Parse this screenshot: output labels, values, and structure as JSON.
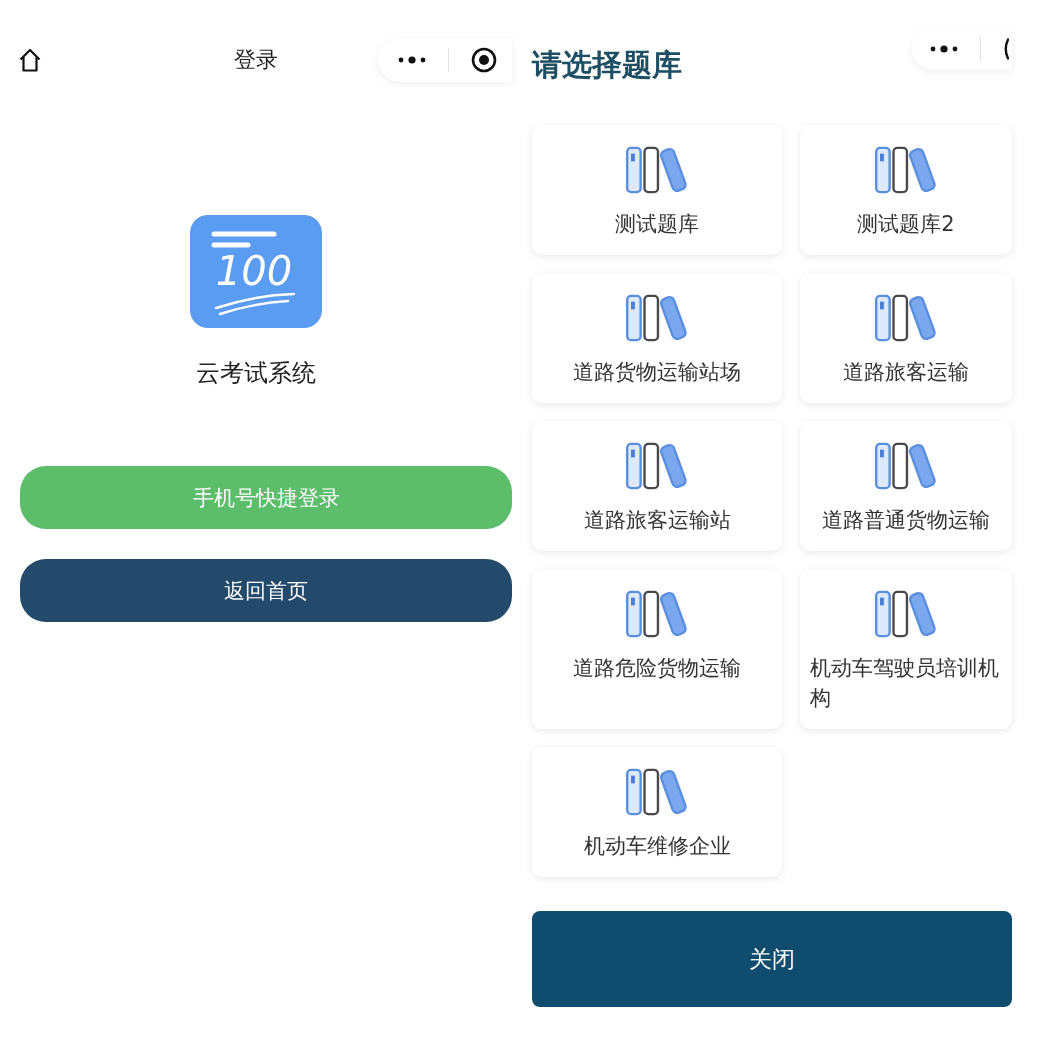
{
  "login_page": {
    "nav_bar": {
      "title": "登录"
    },
    "logo": {
      "text": "100"
    },
    "app_name": "云考试系统",
    "buttons": [
      {
        "label": "手机号快捷登录",
        "kind": "primary"
      },
      {
        "label": "返回首页",
        "kind": "secondary"
      }
    ]
  },
  "bank_picker": {
    "title": "请选择题库",
    "banks": [
      {
        "name": "测试题库"
      },
      {
        "name": "测试题库2"
      },
      {
        "name": "道路货物运输站场"
      },
      {
        "name": "道路旅客运输"
      },
      {
        "name": "道路旅客运输站"
      },
      {
        "name": "道路普通货物运输"
      },
      {
        "name": "道路危险货物运输"
      },
      {
        "name": "机动车驾驶员培训机构"
      },
      {
        "name": "机动车维修企业"
      }
    ],
    "close_button": {
      "label": "关闭"
    }
  }
}
